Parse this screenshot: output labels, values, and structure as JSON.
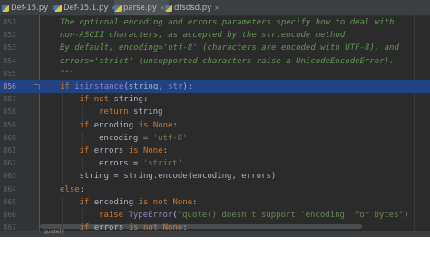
{
  "tabs": [
    {
      "label": "Def-15.py",
      "active": false
    },
    {
      "label": "Def-15.1.py",
      "active": false
    },
    {
      "label": "parse.py",
      "active": true
    },
    {
      "label": "dfsdsd.py",
      "active": false
    }
  ],
  "close_symbol": "×",
  "lines": [
    {
      "num": "851",
      "indent": 0,
      "tokens": [
        {
          "t": "The optional encoding and errors parameters specify how to deal with",
          "c": "doc"
        }
      ]
    },
    {
      "num": "852",
      "indent": 0,
      "tokens": [
        {
          "t": "non-ASCII characters, as accepted by the str.encode method.",
          "c": "doc"
        }
      ]
    },
    {
      "num": "853",
      "indent": 0,
      "tokens": [
        {
          "t": "By default, encoding='utf-8' (characters are encoded with UTF-8), and",
          "c": "doc"
        }
      ]
    },
    {
      "num": "854",
      "indent": 0,
      "tokens": [
        {
          "t": "errors='strict' (unsupported characters raise a UnicodeEncodeError).",
          "c": "doc"
        }
      ]
    },
    {
      "num": "855",
      "indent": 0,
      "tokens": [
        {
          "t": "\"\"\"",
          "c": "doc"
        }
      ]
    },
    {
      "num": "856",
      "indent": 0,
      "current": true,
      "tokens": [
        {
          "t": "if ",
          "c": "kw"
        },
        {
          "t": "isinstance",
          "c": "bi"
        },
        {
          "t": "(string, ",
          "c": ""
        },
        {
          "t": "str",
          "c": "bi"
        },
        {
          "t": "):",
          "c": ""
        }
      ]
    },
    {
      "num": "857",
      "indent": 1,
      "tokens": [
        {
          "t": "if not ",
          "c": "kw"
        },
        {
          "t": "string:",
          "c": ""
        }
      ]
    },
    {
      "num": "858",
      "indent": 2,
      "tokens": [
        {
          "t": "return ",
          "c": "kw"
        },
        {
          "t": "string",
          "c": ""
        }
      ]
    },
    {
      "num": "859",
      "indent": 1,
      "tokens": [
        {
          "t": "if ",
          "c": "kw"
        },
        {
          "t": "encoding ",
          "c": ""
        },
        {
          "t": "is ",
          "c": "kw"
        },
        {
          "t": "None",
          "c": "kw"
        },
        {
          "t": ":",
          "c": ""
        }
      ]
    },
    {
      "num": "860",
      "indent": 2,
      "tokens": [
        {
          "t": "encoding = ",
          "c": ""
        },
        {
          "t": "'utf-8'",
          "c": "str"
        }
      ]
    },
    {
      "num": "861",
      "indent": 1,
      "tokens": [
        {
          "t": "if ",
          "c": "kw"
        },
        {
          "t": "errors ",
          "c": ""
        },
        {
          "t": "is ",
          "c": "kw"
        },
        {
          "t": "None",
          "c": "kw"
        },
        {
          "t": ":",
          "c": ""
        }
      ]
    },
    {
      "num": "862",
      "indent": 2,
      "tokens": [
        {
          "t": "errors = ",
          "c": ""
        },
        {
          "t": "'strict'",
          "c": "str"
        }
      ]
    },
    {
      "num": "863",
      "indent": 1,
      "tokens": [
        {
          "t": "string = string.encode(encoding, errors)",
          "c": ""
        }
      ]
    },
    {
      "num": "864",
      "indent": 0,
      "tokens": [
        {
          "t": "else",
          "c": "kw"
        },
        {
          "t": ":",
          "c": ""
        }
      ]
    },
    {
      "num": "865",
      "indent": 1,
      "tokens": [
        {
          "t": "if ",
          "c": "kw"
        },
        {
          "t": "encoding ",
          "c": ""
        },
        {
          "t": "is not ",
          "c": "kw"
        },
        {
          "t": "None",
          "c": "kw"
        },
        {
          "t": ":",
          "c": ""
        }
      ]
    },
    {
      "num": "866",
      "indent": 2,
      "tokens": [
        {
          "t": "raise ",
          "c": "kw"
        },
        {
          "t": "TypeError",
          "c": "bi"
        },
        {
          "t": "(",
          "c": ""
        },
        {
          "t": "\"quote() doesn't support 'encoding' for bytes\"",
          "c": "str"
        },
        {
          "t": ")",
          "c": ""
        }
      ]
    },
    {
      "num": "867",
      "indent": 1,
      "tokens": [
        {
          "t": "if ",
          "c": "kw"
        },
        {
          "t": "errors ",
          "c": ""
        },
        {
          "t": "is not ",
          "c": "kw"
        },
        {
          "t": "None",
          "c": "kw"
        },
        {
          "t": ":",
          "c": ""
        }
      ]
    }
  ],
  "status_text": "quote()",
  "colors": {
    "keyword": "#cc7832",
    "builtin": "#8888c6",
    "string": "#6a8759",
    "docstring": "#629755",
    "selection": "#214283"
  }
}
